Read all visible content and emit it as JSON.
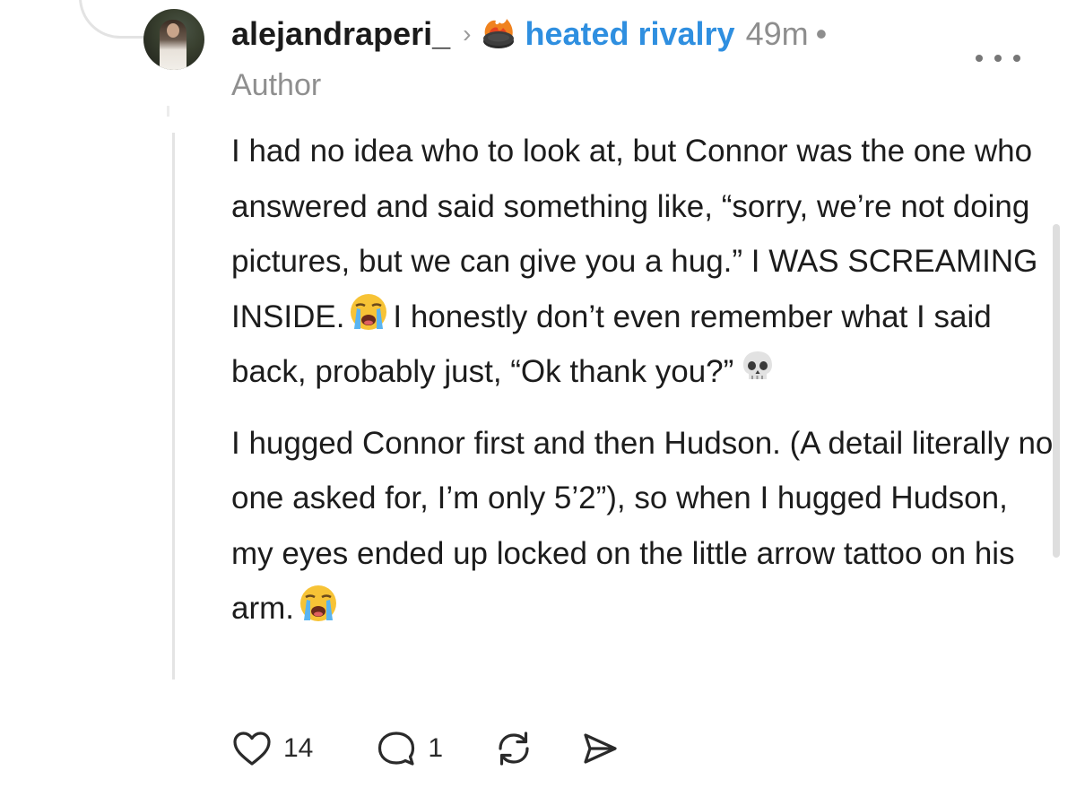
{
  "post": {
    "username": "alejandraperi_",
    "chevron": "›",
    "community": {
      "name": "heated rivalry",
      "icon": "flaming-hockey-puck-icon"
    },
    "timestamp": "49m",
    "dot": "•",
    "author_badge": "Author",
    "body": [
      {
        "before_emoji": "I had no idea who to look at, but Connor was the one who answered and said something like, “sorry, we’re not doing pictures, but we can give you a hug.” I WAS SCREAMING INSIDE.",
        "emoji_1": "loudly-crying-face-icon",
        "after_emoji": "I honestly don’t even remember what I said back, probably just, “Ok thank you?”",
        "emoji_2": "skull-icon"
      },
      {
        "text": "I hugged Connor first and then Hudson. (A detail literally no one asked for, I’m only 5’2”), so when I hugged Hudson, my eyes ended up locked on the little arrow tattoo on his arm.",
        "emoji": "loudly-crying-face-icon"
      }
    ],
    "actions": {
      "likes": "14",
      "replies": "1",
      "repost_icon": "repost-icon",
      "share_icon": "send-icon"
    }
  },
  "colors": {
    "community_link": "#2f8fe0",
    "muted_text": "#8e8e8e",
    "body_text": "#1c1c1c",
    "thread_line": "#e4e4e4"
  }
}
